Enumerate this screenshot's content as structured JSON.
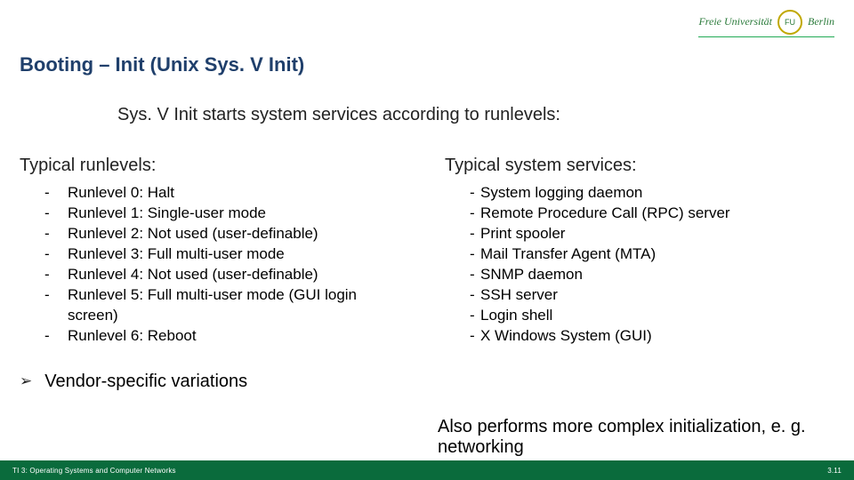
{
  "logo": {
    "text": "Freie Universität",
    "city": "Berlin",
    "seal": "FU"
  },
  "title": "Booting – Init (Unix Sys. V Init)",
  "intro": "Sys. V Init starts system services according to runlevels:",
  "left": {
    "heading": "Typical runlevels:",
    "items": [
      "Runlevel 0: Halt",
      "Runlevel 1: Single-user mode",
      "Runlevel 2: Not used (user-definable)",
      "Runlevel 3: Full multi-user mode",
      "Runlevel 4: Not used (user-definable)",
      "Runlevel 5: Full multi-user mode (GUI login screen)",
      "Runlevel 6: Reboot"
    ]
  },
  "right": {
    "heading": "Typical system services:",
    "items": [
      "System logging daemon",
      "Remote Procedure Call (RPC) server",
      "Print spooler",
      "Mail Transfer Agent (MTA)",
      "SNMP daemon",
      "SSH server",
      "Login shell",
      "X Windows System (GUI)"
    ]
  },
  "arrow_item": "Vendor-specific variations",
  "closing": "Also performs more complex initialization, e. g. networking",
  "footer": {
    "left": "TI 3: Operating Systems and Computer Networks",
    "right": "3.11"
  }
}
